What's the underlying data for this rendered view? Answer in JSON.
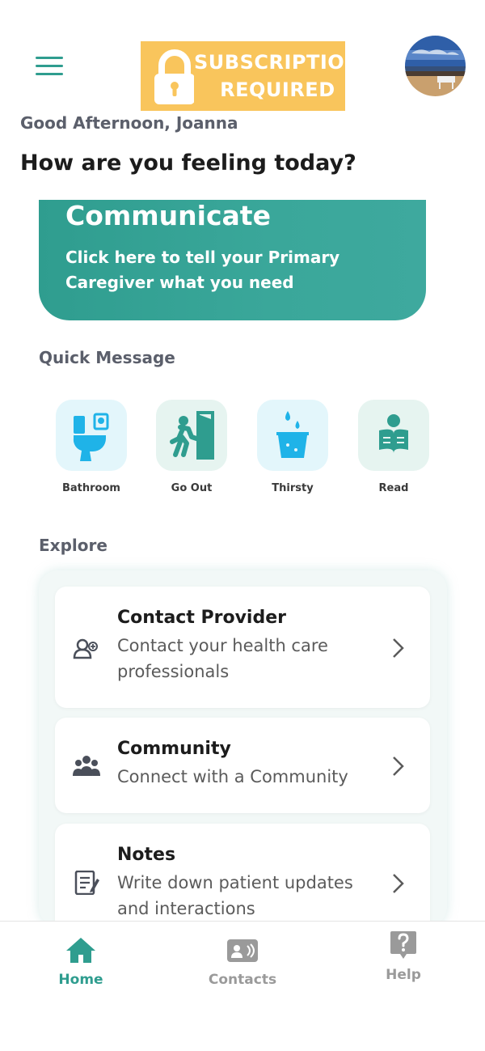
{
  "header": {
    "menu_icon": "hamburger-menu-icon",
    "banner_line1": "SUBSCRIPTION",
    "banner_line2": "REQUIRED",
    "banner_icon": "lock-icon",
    "avatar": "profile-photo"
  },
  "greeting": "Good Afternoon, Joanna",
  "question": "How are you feeling today?",
  "communicate": {
    "title": "Communicate",
    "subtitle": "Click here to tell your Primary Caregiver what you need"
  },
  "quick_message": {
    "heading": "Quick Message",
    "items": [
      {
        "label": "Bathroom",
        "icon": "toilet-icon"
      },
      {
        "label": "Go Out",
        "icon": "exit-door-icon"
      },
      {
        "label": "Thirsty",
        "icon": "water-glass-icon"
      },
      {
        "label": "Read",
        "icon": "reading-book-icon"
      }
    ]
  },
  "explore": {
    "heading": "Explore",
    "cards": [
      {
        "title": "Contact Provider",
        "description": "Contact your health care professionals",
        "icon": "provider-contact-icon"
      },
      {
        "title": "Community",
        "description": "Connect with a Community",
        "icon": "community-group-icon"
      },
      {
        "title": "Notes",
        "description": "Write down patient updates and interactions",
        "icon": "notes-icon"
      }
    ]
  },
  "bottom_nav": {
    "items": [
      {
        "label": "Home",
        "icon": "home-icon"
      },
      {
        "label": "Contacts",
        "icon": "contacts-card-icon"
      },
      {
        "label": "Help",
        "icon": "help-question-icon"
      }
    ]
  },
  "colors": {
    "accent": "#2f9d8f",
    "banner": "#f9c55c",
    "quick_blue": "#1fb3e8",
    "quick_green": "#2f9d8f",
    "muted_text": "#5b5f6b",
    "nav_inactive": "#9a9a9a"
  }
}
